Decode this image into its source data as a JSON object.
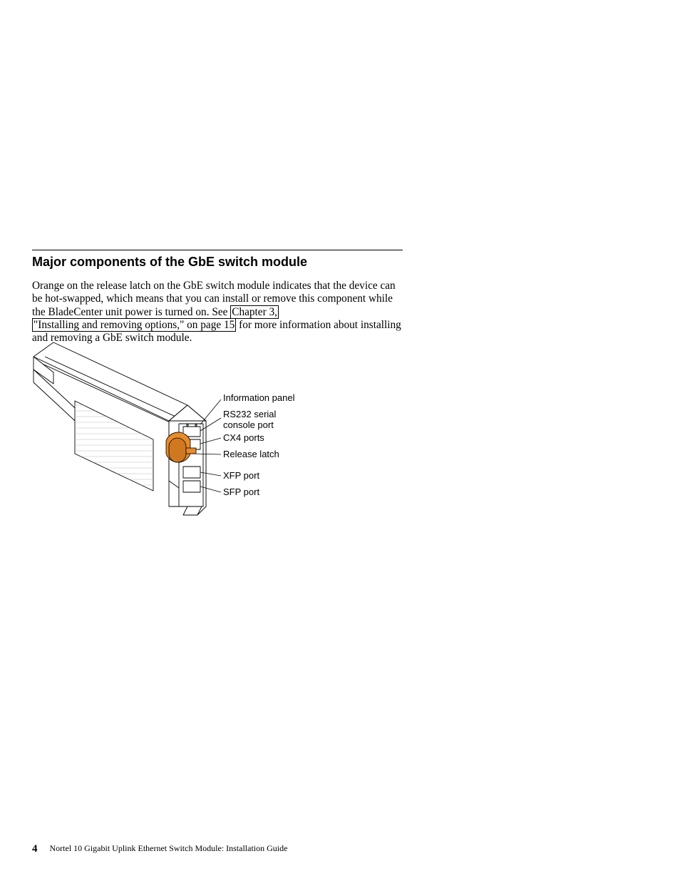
{
  "heading": "Major components of the GbE switch module",
  "para": {
    "t1": "Orange on the release latch on the GbE switch module indicates that the device can be hot-swapped, which means that you can install or remove this component while the BladeCenter unit power is turned on. See ",
    "link1": "Chapter 3,",
    "link2": "\"Installing and removing options,\" on page 15",
    "t2": " for more information about installing and removing a GbE switch module."
  },
  "labels": {
    "info_panel": "Information panel",
    "rs232_l1": "RS232 serial",
    "rs232_l2": "console port",
    "cx4": "CX4 ports",
    "release": "Release latch",
    "xfp": "XFP port",
    "sfp": "SFP port"
  },
  "footer": {
    "page": "4",
    "title": "Nortel 10 Gigabit Uplink Ethernet Switch Module: Installation Guide"
  }
}
